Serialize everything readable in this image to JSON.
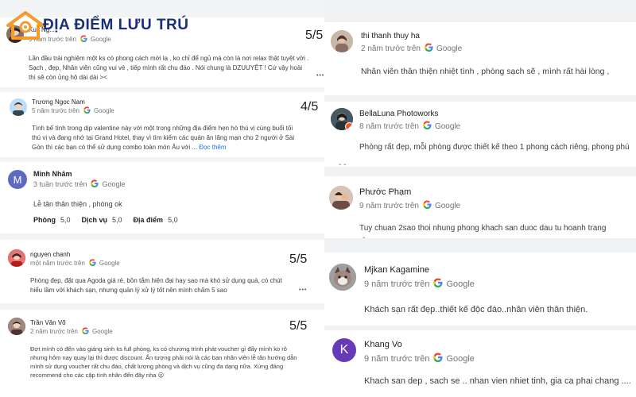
{
  "brand": {
    "logo_text": "ĐỊA ĐIỂM LƯU TRÚ"
  },
  "google_label": "Google",
  "left_reviews": [
    {
      "name": "Kuy Ng...",
      "time": "9 năm trước trên",
      "score": "5/5",
      "text": "Lần đầu trải nghiệm một ks có phong cách mới lạ , ko chỉ để ngủ mà còn là nơi relax thật tuyệt vời . Sạch , đẹp, Nhân viên cũng vui vẻ , tiếp mình rất chu đáo . Nói chung là DZUUYỆT ! Cứ vậy hoài thì sẽ còn ủng hộ dài dài ><"
    },
    {
      "name": "Trương Ngọc Nam",
      "time": "5 năm trước trên",
      "score": "4/5",
      "text": "Tình bế tình trong dịp valentine này với một trong những địa điểm hẹn hò thú vị cùng buổi tối thú vị và đang nhớ tại Grand Hotel, thay vì tìm kiếm các quán ăn lãng mạn cho 2 người ở Sài Gòn thì các bạn có thể sử dụng combo toàn món Âu với ...",
      "read_more": "Đọc thêm"
    },
    {
      "name": "Minh Nhâm",
      "initial": "M",
      "time": "3 tuần trước trên",
      "text": "Lễ tân thân thiện , phòng ok",
      "subscores": [
        {
          "label": "Phòng",
          "value": "5,0"
        },
        {
          "label": "Dịch vụ",
          "value": "5,0"
        },
        {
          "label": "Địa điểm",
          "value": "5,0"
        }
      ]
    },
    {
      "name": "nguyen chanh",
      "time": "một năm trước trên",
      "score": "5/5",
      "text": "Phòng đẹp, đặt qua Agoda giá rẻ, bồn tắm hiện đại hay sao mà khó sử dụng quá, có chút hiểu lầm với khách sạn, nhưng quản lý xử lý tốt nên mình chấm 5 sao"
    },
    {
      "name": "Trần Văn Võ",
      "time": "2 năm trước trên",
      "score": "5/5",
      "text": "Đợt mình có đến vào giáng sinh ks full phòng, ks có chương trình phát voucher gì đấy mình ko rõ nhưng hôm nay quay lại thì được discount. Ấn tượng phải nói là các bạn nhân viên lễ tân hướng dẫn mình sử dụng voucher rất chu đáo, chất lượng phòng và dịch vụ cũng đa dạng nữa. Xứng đáng recommend cho các cặp tình nhân đến đây nha 😛"
    }
  ],
  "right_reviews": [
    {
      "name": "thi thanh thuy ha",
      "time": "2 năm trước trên",
      "text": "Nhân viên thân thiện nhiệt tình , phòng sạch sẽ , mình rất hài lòng ,"
    },
    {
      "name": "BellaLuna Photoworks",
      "time": "8 năm trước trên",
      "text": "Phòng rất đẹp, mỗi phòng được thiết kế theo 1 phong cách riêng, phong phú"
    },
    {
      "name": "Phước Phạm",
      "time": "9 năm trước trên",
      "text": "Tuy chuan 2sao thoi nhung phong khach san duoc dau tu hoanh trang"
    },
    {
      "name": "Mjkan Kagamine",
      "time": "9 năm trước trên",
      "text": "Khách sạn rất đẹp..thiết kế độc đáo..nhân viên thân thiện."
    },
    {
      "name": "Khang Vo",
      "initial": "K",
      "time": "9 năm trước trên",
      "text": "Khach san dep , sach se .. nhan vien nhiet tinh, gia ca phai chang ...."
    }
  ],
  "more_glyph": "•••",
  "colors": {
    "google_blue": "#4285F4",
    "google_red": "#EA4335",
    "google_yellow": "#FBBC05",
    "google_green": "#34A853",
    "avatar_purple_m": "#5c6bc0",
    "avatar_purple_k": "#673ab7",
    "brand_orange": "#f39c2b",
    "brand_navy": "#1a2f7a",
    "link_blue": "#1a73e8"
  }
}
